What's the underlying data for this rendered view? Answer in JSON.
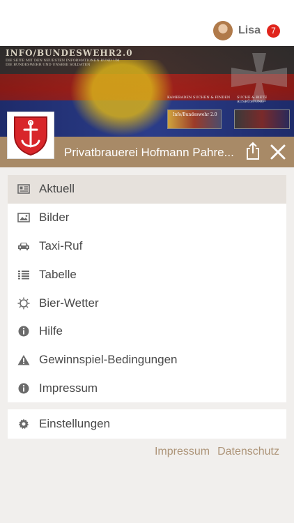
{
  "user": {
    "name": "Lisa",
    "notifications": "7"
  },
  "banner": {
    "title": "INFO/BUNDESWEHR2.0",
    "subtitle": "DIE SEITE MIT DEN NEUESTEN INFORMATIONEN RUND UM DIE BUNDESWEHR UND UNSERE SOLDATEN",
    "link_left": "KAMERADEN SUCHEN & FINDEN",
    "link_right": "SUCHE & BIETE AUSRÜSTUNG",
    "thumb_text": "Info/Bundeswehr 2.0"
  },
  "header": {
    "title": "Privatbrauerei Hofmann Pahre..."
  },
  "menu": {
    "items": [
      {
        "label": "Aktuell",
        "icon": "newspaper-icon",
        "active": true
      },
      {
        "label": "Bilder",
        "icon": "image-icon"
      },
      {
        "label": "Taxi-Ruf",
        "icon": "car-icon"
      },
      {
        "label": "Tabelle",
        "icon": "list-icon"
      },
      {
        "label": "Bier-Wetter",
        "icon": "sun-icon"
      },
      {
        "label": "Hilfe",
        "icon": "info-icon"
      },
      {
        "label": "Gewinnspiel-Bedingungen",
        "icon": "warning-icon"
      },
      {
        "label": "Impressum",
        "icon": "info-icon"
      }
    ],
    "settings": {
      "label": "Einstellungen",
      "icon": "gear-icon"
    }
  },
  "footer": {
    "impressum": "Impressum",
    "datenschutz": "Datenschutz"
  },
  "colors": {
    "accent": "#a88a67",
    "badge": "#e0241b",
    "link": "#ad9478"
  }
}
